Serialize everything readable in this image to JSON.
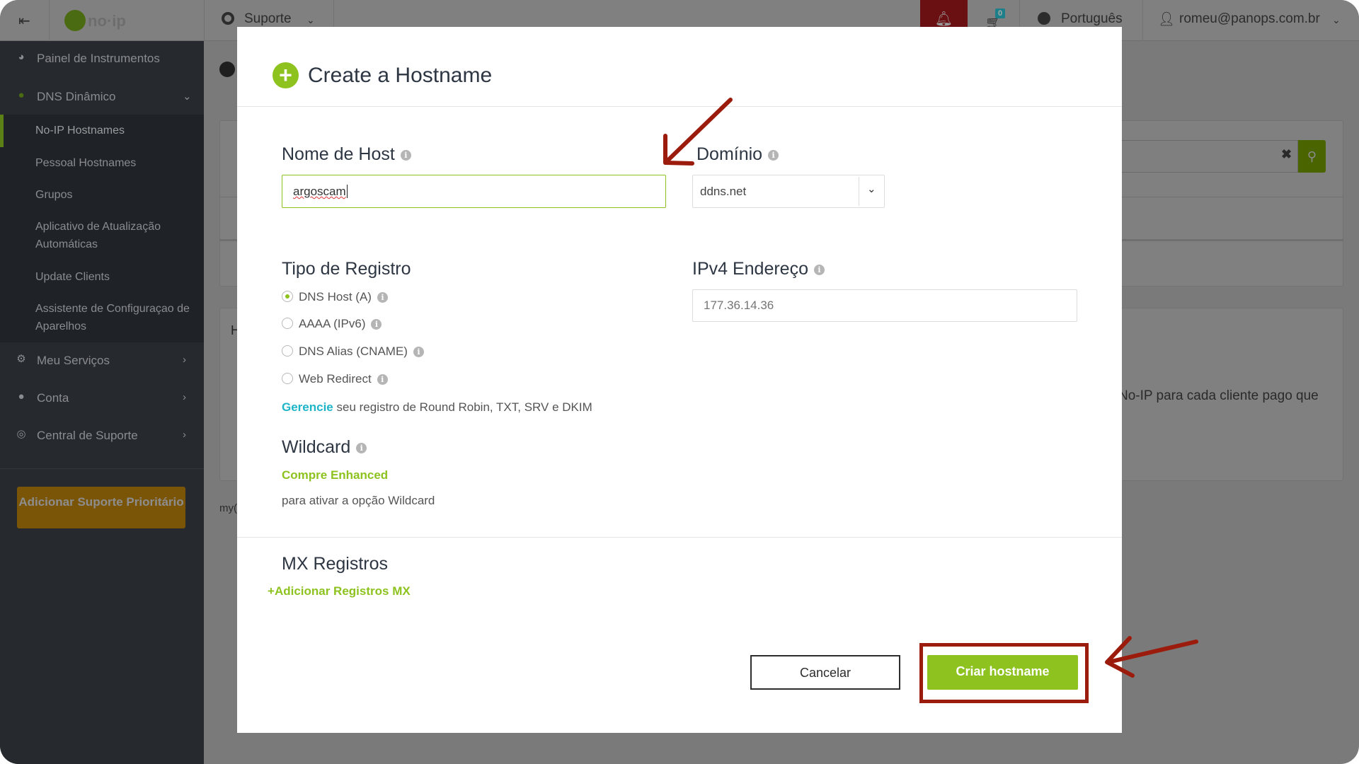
{
  "topbar": {
    "logo": "no-ip",
    "support": "Suporte",
    "notifications_icon": "bell-icon",
    "cart_count": "0",
    "language": "Português",
    "user": "romeu@panops.com.br"
  },
  "sidebar": {
    "items": [
      {
        "label": "Painel de Instrumentos",
        "icon": "dashboard-icon"
      },
      {
        "label": "DNS Dinâmico",
        "icon": "globe-icon"
      },
      {
        "label": "Meu Serviços",
        "icon": "gear-icon"
      },
      {
        "label": "Conta",
        "icon": "user-icon"
      },
      {
        "label": "Central de Suporte",
        "icon": "lifebuoy-icon"
      }
    ],
    "submenu": [
      "No-IP Hostnames",
      "Pessoal Hostnames",
      "Grupos",
      "Aplicativo de Atualização Automáticas",
      "Update Clients",
      "Assistente de Configuraçao de Aparelhos"
    ],
    "active_submenu": "No-IP Hostnames",
    "priority_button": "Adicionar Suporte Prioritário"
  },
  "background": {
    "panel_text": "No-IP para cada cliente pago que",
    "heading_fragment": "H",
    "footer_fragment": "my("
  },
  "modal": {
    "title": "Create a Hostname",
    "hostname_label": "Nome de Host",
    "hostname_value": "argoscam",
    "domain_label": "Domínio",
    "domain_value": "ddns.net",
    "record_type_label": "Tipo de Registro",
    "record_types": [
      {
        "label": "DNS Host (A)",
        "selected": true
      },
      {
        "label": "AAAA (IPv6)",
        "selected": false
      },
      {
        "label": "DNS Alias (CNAME)",
        "selected": false
      },
      {
        "label": "Web Redirect",
        "selected": false
      }
    ],
    "ipv4_label": "IPv4 Endereço",
    "ipv4_placeholder": "177.36.14.36",
    "manage_link": "Gerencie",
    "manage_text": "seu registro de Round Robin, TXT, SRV e DKIM",
    "wildcard_label": "Wildcard",
    "wildcard_link": "Compre Enhanced",
    "wildcard_text": "para ativar a opção Wildcard",
    "mx_label": "MX Registros",
    "mx_add": "Adicionar Registros MX",
    "cancel": "Cancelar",
    "create": "Criar hostname"
  },
  "colors": {
    "accent": "#8dc21f",
    "annotation": "#9b1c0c",
    "link": "#1fb5c9"
  }
}
